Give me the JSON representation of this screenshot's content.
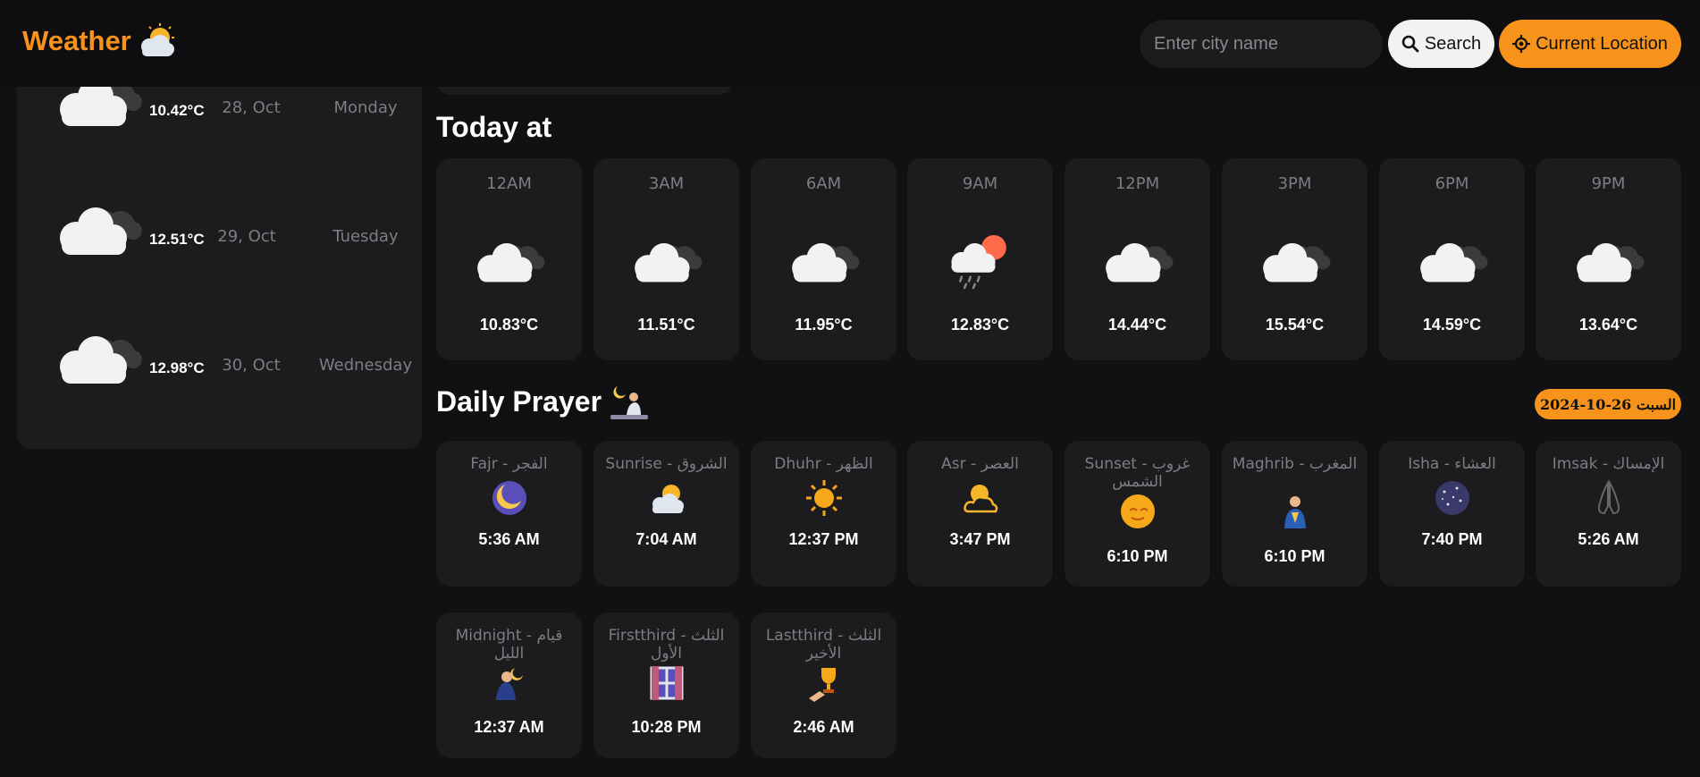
{
  "header": {
    "logo_text": "Weather",
    "search_placeholder": "Enter city name",
    "search_label": "Search",
    "location_label": "Current Location",
    "accent": "#f7931a"
  },
  "forecast": [
    {
      "temp": "10.42°C",
      "date": "28, Oct",
      "day": "Monday",
      "icon": "cloud-icon"
    },
    {
      "temp": "12.51°C",
      "date": "29, Oct",
      "day": "Tuesday",
      "icon": "cloud-icon"
    },
    {
      "temp": "12.98°C",
      "date": "30, Oct",
      "day": "Wednesday",
      "icon": "cloud-icon"
    }
  ],
  "today": {
    "title": "Today at",
    "hours": [
      {
        "time": "12AM",
        "temp": "10.83°C",
        "icon": "cloud-icon"
      },
      {
        "time": "3AM",
        "temp": "11.51°C",
        "icon": "cloud-icon"
      },
      {
        "time": "6AM",
        "temp": "11.95°C",
        "icon": "cloud-icon"
      },
      {
        "time": "9AM",
        "temp": "12.83°C",
        "icon": "sun-rain-icon"
      },
      {
        "time": "12PM",
        "temp": "14.44°C",
        "icon": "cloud-icon"
      },
      {
        "time": "3PM",
        "temp": "15.54°C",
        "icon": "cloud-icon"
      },
      {
        "time": "6PM",
        "temp": "14.59°C",
        "icon": "cloud-icon"
      },
      {
        "time": "9PM",
        "temp": "13.64°C",
        "icon": "cloud-icon"
      }
    ]
  },
  "prayer": {
    "title": "Daily Prayer",
    "date_badge": "السبت 26-10-2024",
    "items": [
      {
        "name": "Fajr - الفجر",
        "time": "5:36 AM",
        "icon": "moon-icon"
      },
      {
        "name": "Sunrise - الشروق",
        "time": "7:04 AM",
        "icon": "sun-behind-cloud-icon"
      },
      {
        "name": "Dhuhr - الظهر",
        "time": "12:37 PM",
        "icon": "sun-icon"
      },
      {
        "name": "Asr - العصر",
        "time": "3:47 PM",
        "icon": "sun-cloud-outline-icon"
      },
      {
        "name": "Sunset - غروب الشمس",
        "time": "6:10 PM",
        "icon": "sunset-face-icon"
      },
      {
        "name": "Maghrib - المغرب",
        "time": "6:10 PM",
        "icon": "praying-person-icon"
      },
      {
        "name": "Isha - العشاء",
        "time": "7:40 PM",
        "icon": "stars-icon"
      },
      {
        "name": "Imsak - الإمساك",
        "time": "5:26 AM",
        "icon": "praying-hands-icon"
      },
      {
        "name": "Midnight - قيام الليل",
        "time": "12:37 AM",
        "icon": "night-prayer-icon"
      },
      {
        "name": "Firstthird - الثلث الأول",
        "time": "10:28 PM",
        "icon": "window-night-icon"
      },
      {
        "name": "Lastthird - الثلث الأخير",
        "time": "2:46 AM",
        "icon": "trophy-hand-icon"
      }
    ]
  }
}
